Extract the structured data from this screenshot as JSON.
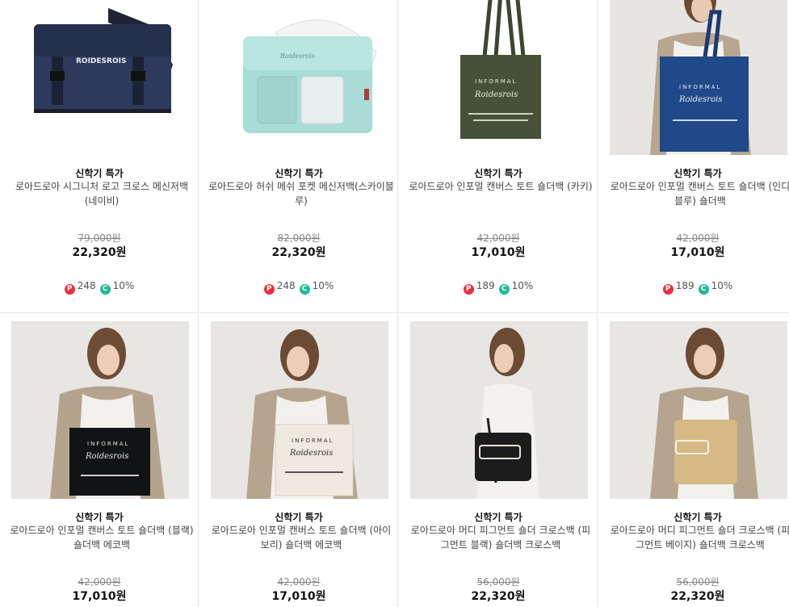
{
  "colors": {
    "point": "#e8313b",
    "coupon": "#20b89a"
  },
  "products": [
    {
      "tag": "신학기 특가",
      "name": "로아드로아 시그니처 로고 크로스 메신저백 (네이비)",
      "old_price": "79,000원",
      "price": "22,320원",
      "points": "248",
      "coupon": "10%"
    },
    {
      "tag": "신학기 특가",
      "name": "로아드로아 허쉬 메쉬 포켓 메신저백(스카이블루)",
      "old_price": "82,000원",
      "price": "22,320원",
      "points": "248",
      "coupon": "10%"
    },
    {
      "tag": "신학기 특가",
      "name": "로아드로아 인포멀 캔버스 토트 숄더백 (카키)",
      "old_price": "42,000원",
      "price": "17,010원",
      "points": "189",
      "coupon": "10%"
    },
    {
      "tag": "신학기 특가",
      "name": "로아드로아 인포멀 캔버스 토트 숄더백 (인디블루) 숄더백",
      "old_price": "42,000원",
      "price": "17,010원",
      "points": "189",
      "coupon": "10%"
    },
    {
      "tag": "신학기 특가",
      "name": "로아드로아 인포멀 캔버스 토트 숄더백 (블랙) 숄더백 에코백",
      "old_price": "42,000원",
      "price": "17,010원"
    },
    {
      "tag": "신학기 특가",
      "name": "로아드로아 인포멀 캔버스 토트 숄더백 (아이보리) 숄더백 에코백",
      "old_price": "42,000원",
      "price": "17,010원"
    },
    {
      "tag": "신학기 특가",
      "name": "로아드로아 머디 피그먼트 숄더 크로스백 (피그먼트 블랙) 숄더백 크로스백",
      "old_price": "56,000원",
      "price": "22,320원"
    },
    {
      "tag": "신학기 특가",
      "name": "로아드로아 머디 피그먼트 숄더 크로스백 (피그먼트 베이지) 숄더백 크로스백",
      "old_price": "56,000원",
      "price": "22,320원"
    }
  ]
}
